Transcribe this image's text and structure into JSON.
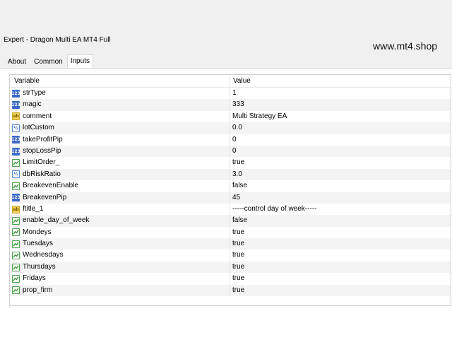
{
  "window": {
    "title": "Expert - Dragon Multi EA MT4 Full"
  },
  "watermark": "www.mt4.shop",
  "tabs": [
    {
      "label": "About"
    },
    {
      "label": "Common"
    },
    {
      "label": "Inputs"
    }
  ],
  "table": {
    "headers": [
      "Variable",
      "Value"
    ],
    "rows": [
      {
        "icon": "int",
        "name": "strType",
        "value": "1"
      },
      {
        "icon": "int",
        "name": "magic",
        "value": "333"
      },
      {
        "icon": "str",
        "name": "comment",
        "value": "Multi Strategy EA"
      },
      {
        "icon": "dbl",
        "name": "lotCustom",
        "value": "0.0"
      },
      {
        "icon": "int",
        "name": "takeProfitPip",
        "value": "0"
      },
      {
        "icon": "int",
        "name": "stopLossPip",
        "value": "0"
      },
      {
        "icon": "bool",
        "name": "LimitOrder_",
        "value": "true"
      },
      {
        "icon": "dbl",
        "name": "dbRiskRatio",
        "value": "3.0"
      },
      {
        "icon": "bool",
        "name": "BreakevenEnable",
        "value": "false"
      },
      {
        "icon": "int",
        "name": "BreakevenPip",
        "value": "45"
      },
      {
        "icon": "str",
        "name": "ftitle_1",
        "value": "-----control day of week-----"
      },
      {
        "icon": "bool",
        "name": "enable_day_of_week",
        "value": "false"
      },
      {
        "icon": "bool",
        "name": "Mondeys",
        "value": "true"
      },
      {
        "icon": "bool",
        "name": "Tuesdays",
        "value": "true"
      },
      {
        "icon": "bool",
        "name": "Wednesdays",
        "value": "true"
      },
      {
        "icon": "bool",
        "name": "Thursdays",
        "value": "true"
      },
      {
        "icon": "bool",
        "name": "Fridays",
        "value": "true"
      },
      {
        "icon": "bool",
        "name": "prop_firm",
        "value": "true"
      }
    ]
  }
}
